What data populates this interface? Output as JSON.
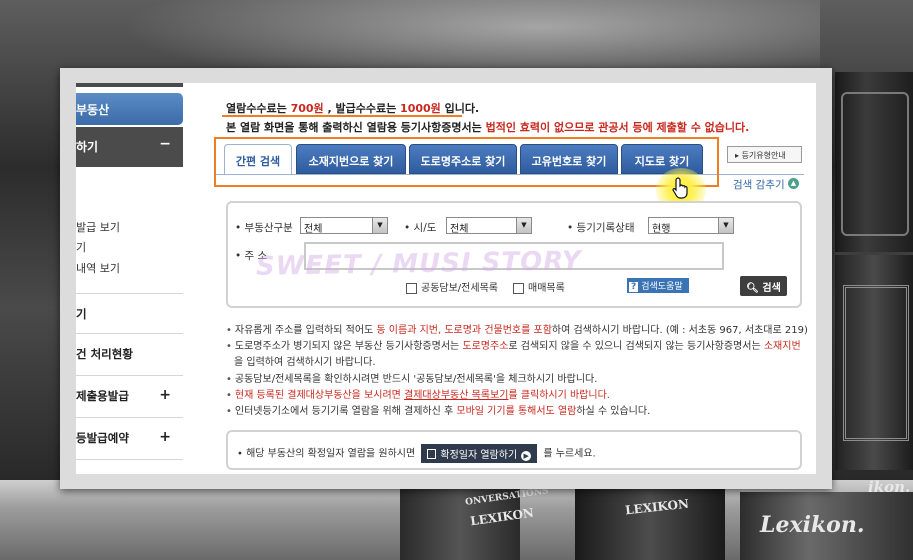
{
  "background_books": [
    "ONVERSATIONS",
    "LEXIKON",
    "LEXIKON",
    "Lexikon.",
    "ikon."
  ],
  "sidebar": {
    "tab_label": "부동산",
    "menu_label": "하기",
    "menu_toggle": "−",
    "sub_items": [
      "발급 보기",
      "기",
      "내역 보기"
    ],
    "links": [
      {
        "label": "기",
        "toggle": ""
      },
      {
        "label": "건 처리현황",
        "toggle": ""
      },
      {
        "label": "제출용발급",
        "toggle": "+"
      },
      {
        "label": "등발급예약",
        "toggle": "+"
      }
    ]
  },
  "notice": {
    "line1_a": "열람수수료는 ",
    "line1_fee1": "700원",
    "line1_b": " , 발급수수료는 ",
    "line1_fee2": "1000원",
    "line1_c": " 입니다.",
    "line2_a": "본 열람 화면을 통해 출력하신 열람용 등기사항증명서는 ",
    "line2_hl": "법적인 효력이 없으므로 관공서 등에 제출할 수 없습니다."
  },
  "tabs": [
    "간편 검색",
    "소재지번으로 찾기",
    "도로명주소로 찾기",
    "고유번호로 찾기",
    "지도로 찾기"
  ],
  "help_tab": "등기유형안내",
  "collapse_label": "검색 감추기",
  "form": {
    "type_label": "부동산구분",
    "type_value": "전체",
    "region_label": "시/도",
    "region_value": "전체",
    "status_label": "등기기록상태",
    "status_value": "현행",
    "address_label": "주 소",
    "address_value": "",
    "checkbox1": "공동담보/전세목록",
    "checkbox2": "매매목록",
    "help_button": "검색도움말",
    "search_button": "검색"
  },
  "watermark": "SWEET / MUSI STORY",
  "notes": {
    "n1_a": "자유롭게 주소를 입력하되 적어도 ",
    "n1_hl": "동 이름과 지번, 도로명과 건물번호를 포함",
    "n1_b": "하여 검색하시기 바랍니다. (예 : 서초동 967, 서초대로 219)",
    "n2_a": "도로명주소가 병기되지 않은 부동산 등기사항증명서는 ",
    "n2_hl1": "도로명주소",
    "n2_b": "로 검색되지 않을 수 있으니 검색되지 않는 등기사항증명서는 ",
    "n2_hl2": "소재지번",
    "n2_c": "을 입력하여 검색하시기 바랍니다.",
    "n3": "공동담보/전세목록을 확인하시려면 반드시 '공동담보/전세목록'을 체크하시기 바랍니다.",
    "n4_hl1": "현재 등록된 결제대상부동산을 보시려면 ",
    "n4_hl2": "결제대상부동산 목록보기",
    "n4_hl3": "를 클릭하시기 바랍니다.",
    "n5_a": "인터넷등기소에서 등기기록 열람을 위해 결제하신 후 ",
    "n5_hl": "모바일 기기를 통해서도 열람",
    "n5_b": "하실 수 있습니다."
  },
  "confirm": {
    "text_a": "해당 부동산의 확정일자 열람을 원하시면 ",
    "button": "확정일자 열람하기",
    "text_b": " 를 누르세요."
  },
  "colors": {
    "accent_blue": "#2e5c9f",
    "highlight_red": "#c8281e",
    "annotation_orange": "#ef7d22"
  }
}
